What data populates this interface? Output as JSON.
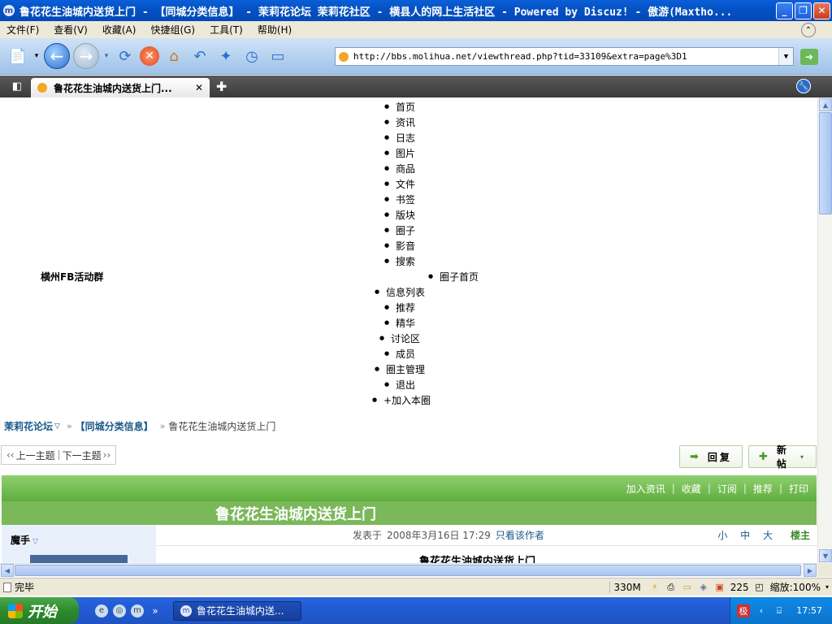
{
  "window": {
    "title": "鲁花花生油城内送货上门 - 【同城分类信息】 - 茉莉花论坛 茉莉花社区 - 横县人的网上生活社区 - Powered by Discuz! - 傲游(Maxtho..."
  },
  "menu": {
    "items": [
      "文件(F)",
      "查看(V)",
      "收藏(A)",
      "快捷组(G)",
      "工具(T)",
      "帮助(H)"
    ]
  },
  "address": {
    "url": "http://bbs.molihua.net/viewthread.php?tid=33109&extra=page%3D1"
  },
  "tab": {
    "label": "鲁花花生油城内送货上门..."
  },
  "page": {
    "group_name": "横州FB活动群",
    "nav": [
      {
        "label": "首页"
      },
      {
        "label": "资讯"
      },
      {
        "label": "日志"
      },
      {
        "label": "图片"
      },
      {
        "label": "商品"
      },
      {
        "label": "文件"
      },
      {
        "label": "书签"
      },
      {
        "label": "版块"
      },
      {
        "label": "圈子"
      },
      {
        "label": "影音"
      },
      {
        "label": "搜索"
      },
      {
        "label": "圈子首页"
      },
      {
        "label": "信息列表"
      },
      {
        "label": "推荐"
      },
      {
        "label": "精华"
      },
      {
        "label": "讨论区"
      },
      {
        "label": "成员"
      },
      {
        "label": "圈主管理"
      },
      {
        "label": "退出"
      },
      {
        "label": "+加入本圈"
      }
    ],
    "breadcrumb": {
      "home": "茉莉花论坛",
      "category": "【同城分类信息】",
      "current": "鲁花花生油城内送货上门",
      "sep": "»"
    },
    "pager": {
      "prev": "上一主题",
      "next": "下一主题"
    },
    "buttons": {
      "reply": "回复",
      "new_post": "新帖"
    },
    "post_actions": [
      "加入资讯",
      "收藏",
      "订阅",
      "推荐",
      "打印"
    ],
    "thread_title": "鲁花花生油城内送货上门",
    "author": "魔手",
    "posted_label": "发表于",
    "posted_at": "2008年3月16日 17:29",
    "only_author": "只看该作者",
    "font_sizes": "小 中 大",
    "floor": "楼主",
    "body_title": "鲁花花生油城内送货上门"
  },
  "status": {
    "text": "完毕",
    "memory": "330M",
    "count": "225",
    "zoom": "缩放:100%"
  },
  "taskbar": {
    "start": "开始",
    "task": "鲁花花生油城内送...",
    "clock": "17:57"
  }
}
